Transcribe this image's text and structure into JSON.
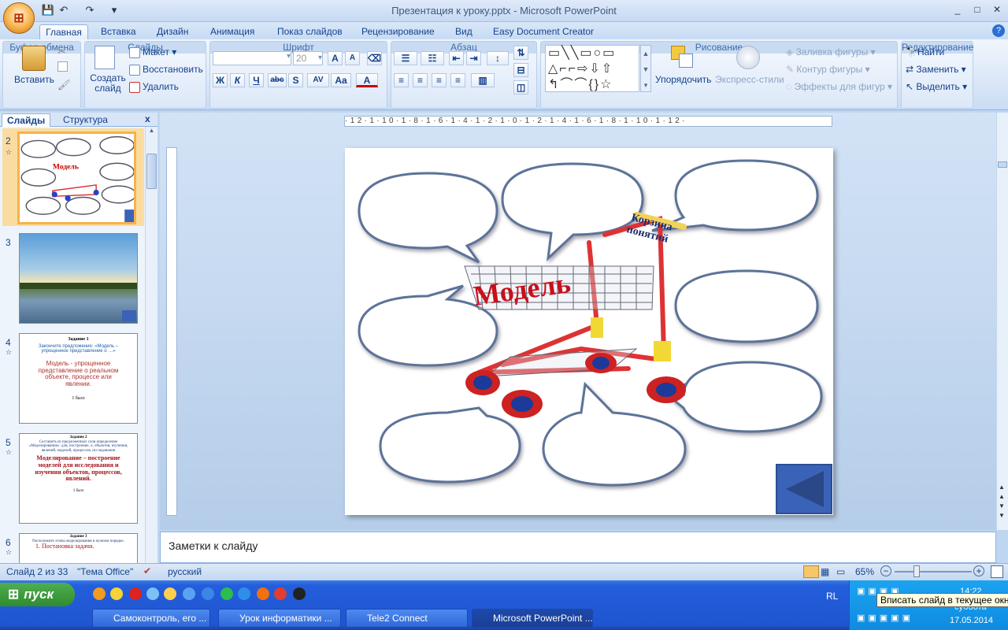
{
  "app": {
    "title": "Презентация к уроку.pptx - Microsoft PowerPoint",
    "office_logo": "office-logo",
    "qat": [
      "save-icon",
      "undo-icon",
      "redo-icon",
      "customize-icon"
    ],
    "window_buttons": [
      "_",
      "□",
      "✕"
    ]
  },
  "tabs": [
    "Главная",
    "Вставка",
    "Дизайн",
    "Анимация",
    "Показ слайдов",
    "Рецензирование",
    "Вид",
    "Easy Document Creator"
  ],
  "ribbon": {
    "clipboard": {
      "label": "Буфер обмена",
      "paste": "Вставить"
    },
    "slides": {
      "label": "Слайды",
      "new_slide": "Создать слайд",
      "layout": "Макет",
      "reset": "Восстановить",
      "delete": "Удалить"
    },
    "font": {
      "label": "Шрифт",
      "font_name": "",
      "font_size": "20",
      "bold": "Ж",
      "italic": "К",
      "underline": "Ч",
      "strike": "abc",
      "shadow": "S",
      "spacing": "AV",
      "case": "Aa",
      "color": "A",
      "grow": "A",
      "shrink": "A"
    },
    "paragraph": {
      "label": "Абзац"
    },
    "drawing": {
      "label": "Рисование",
      "arrange": "Упорядочить",
      "quick_styles": "Экспресс-стили",
      "fill": "Заливка фигуры",
      "outline": "Контур фигуры",
      "effects": "Эффекты для фигур"
    },
    "editing": {
      "label": "Редактирование",
      "find": "Найти",
      "replace": "Заменить",
      "select": "Выделить"
    }
  },
  "left_pane": {
    "tabs": [
      "Слайды",
      "Структура"
    ],
    "close": "x",
    "slides": [
      {
        "num": "2",
        "title_word": "Модель",
        "selected": true
      },
      {
        "num": "3",
        "image": "lake-landscape"
      },
      {
        "num": "4",
        "heading": "Задание 1",
        "prompt": "Закончите предложение: «Модель – упрощенное представление о …»",
        "answer": "Модель - упрощенное представление о реальном объекте, процессе или явлении.",
        "score": "1 балл"
      },
      {
        "num": "5",
        "heading": "Задание 2",
        "prompt": "Составить из предложенных слов определение «Моделирование»: для, построение, о, объектов, изучения, явлений, моделей, процессов, исследования",
        "answer": "Моделирование – построение моделей для исследования и изучения объектов, процессов, явлений.",
        "score": "1 балл"
      },
      {
        "num": "6",
        "heading": "Задание 3",
        "prompt": "Расположите этапы моделирования в нужном порядке.",
        "answer": "1.  Постановка задачи."
      }
    ]
  },
  "slide": {
    "cart_label": "Корзина понятий",
    "center_word": "Модель",
    "nav_icon": "back-arrow-icon",
    "bubbles": 9
  },
  "ruler": {
    "h": "·12·1·10·1·8·1·6·1·4·1·2·1·0·1·2·1·4·1·6·1·8·1·10·1·12·"
  },
  "notes": {
    "placeholder": "Заметки к слайду"
  },
  "status": {
    "slide": "Слайд 2 из 33",
    "theme": "\"Тема Office\"",
    "language": "русский",
    "zoom": "65%"
  },
  "taskbar": {
    "start": "пуск",
    "windows": [
      "Самоконтроль, его ...",
      "Урок информатики ...",
      "Tele2 Connect",
      "Microsoft PowerPoint ..."
    ],
    "lang": "RL",
    "tooltip": "Вписать слайд в текущее окно",
    "time": "14:22",
    "day": "суббота",
    "date": "17.05.2014"
  }
}
